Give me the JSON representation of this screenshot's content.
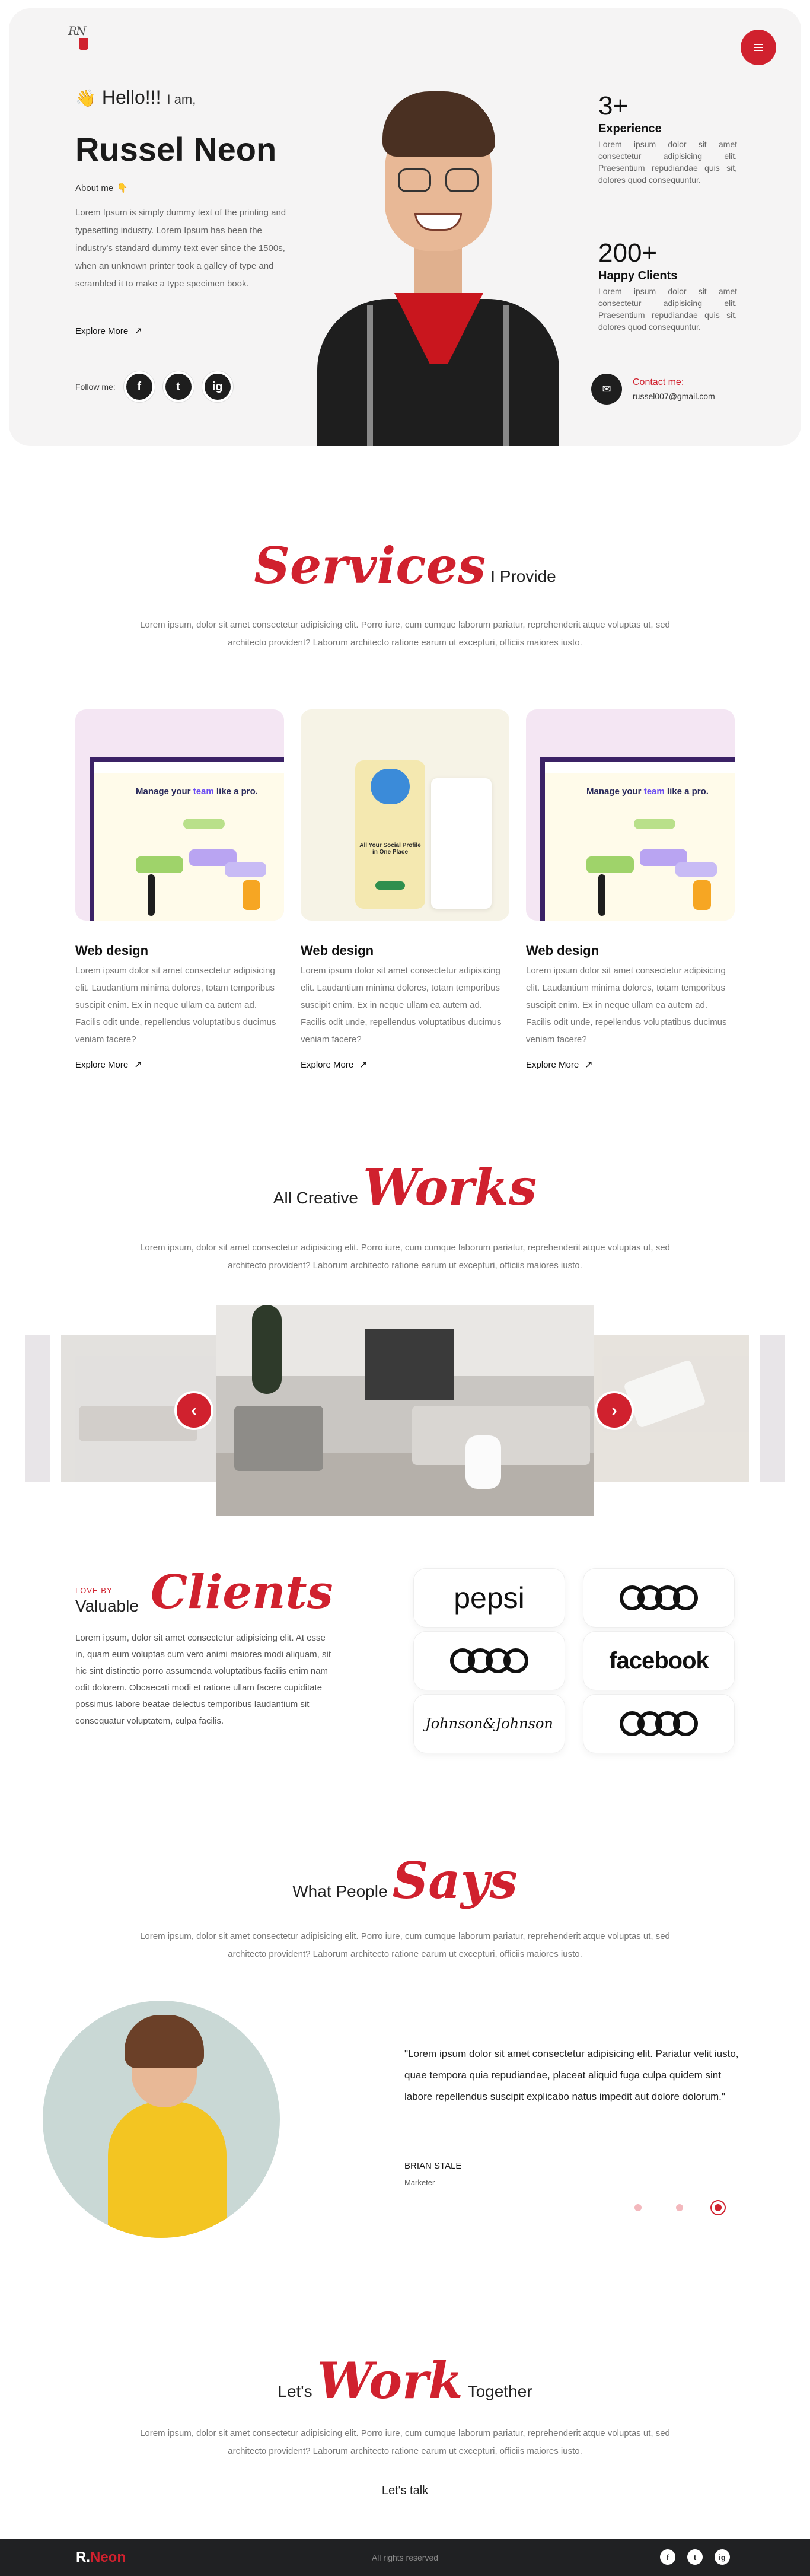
{
  "hero": {
    "logo_initials": "RN",
    "hello": "Hello!!!",
    "i_am": "I am,",
    "name": "Russel Neon",
    "about_label": "About me",
    "intro": "Lorem Ipsum is simply dummy text of the printing and typesetting industry. Lorem Ipsum has been the industry's standard dummy text ever since the 1500s, when an unknown printer took a galley of type and scrambled it to make a type specimen book.",
    "explore": "Explore More",
    "follow_label": "Follow me:",
    "social": [
      "f",
      "t",
      "ig"
    ],
    "stats": [
      {
        "number": "3+",
        "label": "Experience",
        "text": "Lorem ipsum dolor sit amet consectetur adipisicing elit. Praesentium repudiandae quis sit, dolores quod consequuntur."
      },
      {
        "number": "200+",
        "label": "Happy Clients",
        "text": "Lorem ipsum dolor sit amet consectetur adipisicing elit. Praesentium repudiandae quis sit, dolores quod consequuntur."
      }
    ],
    "contact_label": "Contact me:",
    "email": "russel007@gmail.com"
  },
  "services": {
    "script": "Services",
    "plain": "I Provide",
    "desc": "Lorem ipsum, dolor sit amet consectetur adipisicing elit. Porro iure, cum cumque laborum pariatur, reprehenderit atque voluptas ut, sed architecto provident? Laborum architecto ratione earum ut excepturi, officiis maiores iusto.",
    "cards": [
      {
        "title": "Web design",
        "mock_head_a": "Manage your",
        "mock_head_b": "team",
        "mock_head_c": "like a pro.",
        "text": "Lorem ipsum dolor sit amet consectetur adipisicing elit. Laudantium minima dolores, totam temporibus suscipit enim. Ex in neque ullam ea autem ad. Facilis odit unde, repellendus voluptatibus ducimus veniam facere?",
        "explore": "Explore More"
      },
      {
        "title": "Web design",
        "mock_head_a": "All Your Social",
        "mock_head_b": "Profile",
        "mock_head_c": "in One Place",
        "text": "Lorem ipsum dolor sit amet consectetur adipisicing elit. Laudantium minima dolores, totam temporibus suscipit enim. Ex in neque ullam ea autem ad. Facilis odit unde, repellendus voluptatibus ducimus veniam facere?",
        "explore": "Explore More"
      },
      {
        "title": "Web design",
        "mock_head_a": "Manage your",
        "mock_head_b": "team",
        "mock_head_c": "like a pro.",
        "text": "Lorem ipsum dolor sit amet consectetur adipisicing elit. Laudantium minima dolores, totam temporibus suscipit enim. Ex in neque ullam ea autem ad. Facilis odit unde, repellendus voluptatibus ducimus veniam facere?",
        "explore": "Explore More"
      }
    ]
  },
  "works": {
    "plain": "All Creative",
    "script": "Works",
    "desc": "Lorem ipsum, dolor sit amet consectetur adipisicing elit. Porro iure, cum cumque laborum pariatur, reprehenderit atque voluptas ut, sed architecto provident? Laborum architecto ratione earum ut excepturi, officiis maiores iusto.",
    "prev": "‹",
    "next": "›"
  },
  "clients": {
    "love": "LOVE BY",
    "valuable": "Valuable",
    "script": "Clients",
    "text": "Lorem ipsum, dolor sit amet consectetur adipisicing elit. At esse in, quam eum voluptas cum vero animi maiores modi aliquam, sit hic sint distinctio porro assumenda voluptatibus facilis enim nam odit dolorem. Obcaecati modi et ratione ullam facere cupiditate possimus labore beatae delectus temporibus laudantium sit consequatur voluptatem, culpa facilis.",
    "logos": [
      "pepsi",
      "facebook",
      "Johnson&Johnson"
    ]
  },
  "testimonial": {
    "plain": "What People",
    "script": "Says",
    "desc": "Lorem ipsum, dolor sit amet consectetur adipisicing elit. Porro iure, cum cumque laborum pariatur, reprehenderit atque voluptas ut, sed architecto provident? Laborum architecto ratione earum ut excepturi, officiis maiores iusto.",
    "quote": "\"Lorem ipsum dolor sit amet consectetur adipisicing elit. Pariatur velit iusto, quae tempora quia repudiandae, placeat aliquid fuga culpa quidem sint labore repellendus suscipit explicabo natus impedit aut dolore dolorum.\"",
    "name": "BRIAN STALE",
    "role": "Marketer"
  },
  "cta": {
    "plain_a": "Let's",
    "script": "Work",
    "plain_b": "Together",
    "desc": "Lorem ipsum, dolor sit amet consectetur adipisicing elit. Porro iure, cum cumque laborum pariatur, reprehenderit atque voluptas ut, sed architecto provident? Laborum architecto ratione earum ut excepturi, officiis maiores iusto.",
    "button": "Let's talk"
  },
  "footer": {
    "brand_a": "R.",
    "brand_b": "Neon",
    "copy": "All rights reserved",
    "icons": [
      "f",
      "t",
      "ig"
    ]
  },
  "colors": {
    "accent": "#d0212e",
    "dark": "#1e1e1e",
    "hero_bg": "#f5f4f4",
    "footer": "#202123"
  }
}
